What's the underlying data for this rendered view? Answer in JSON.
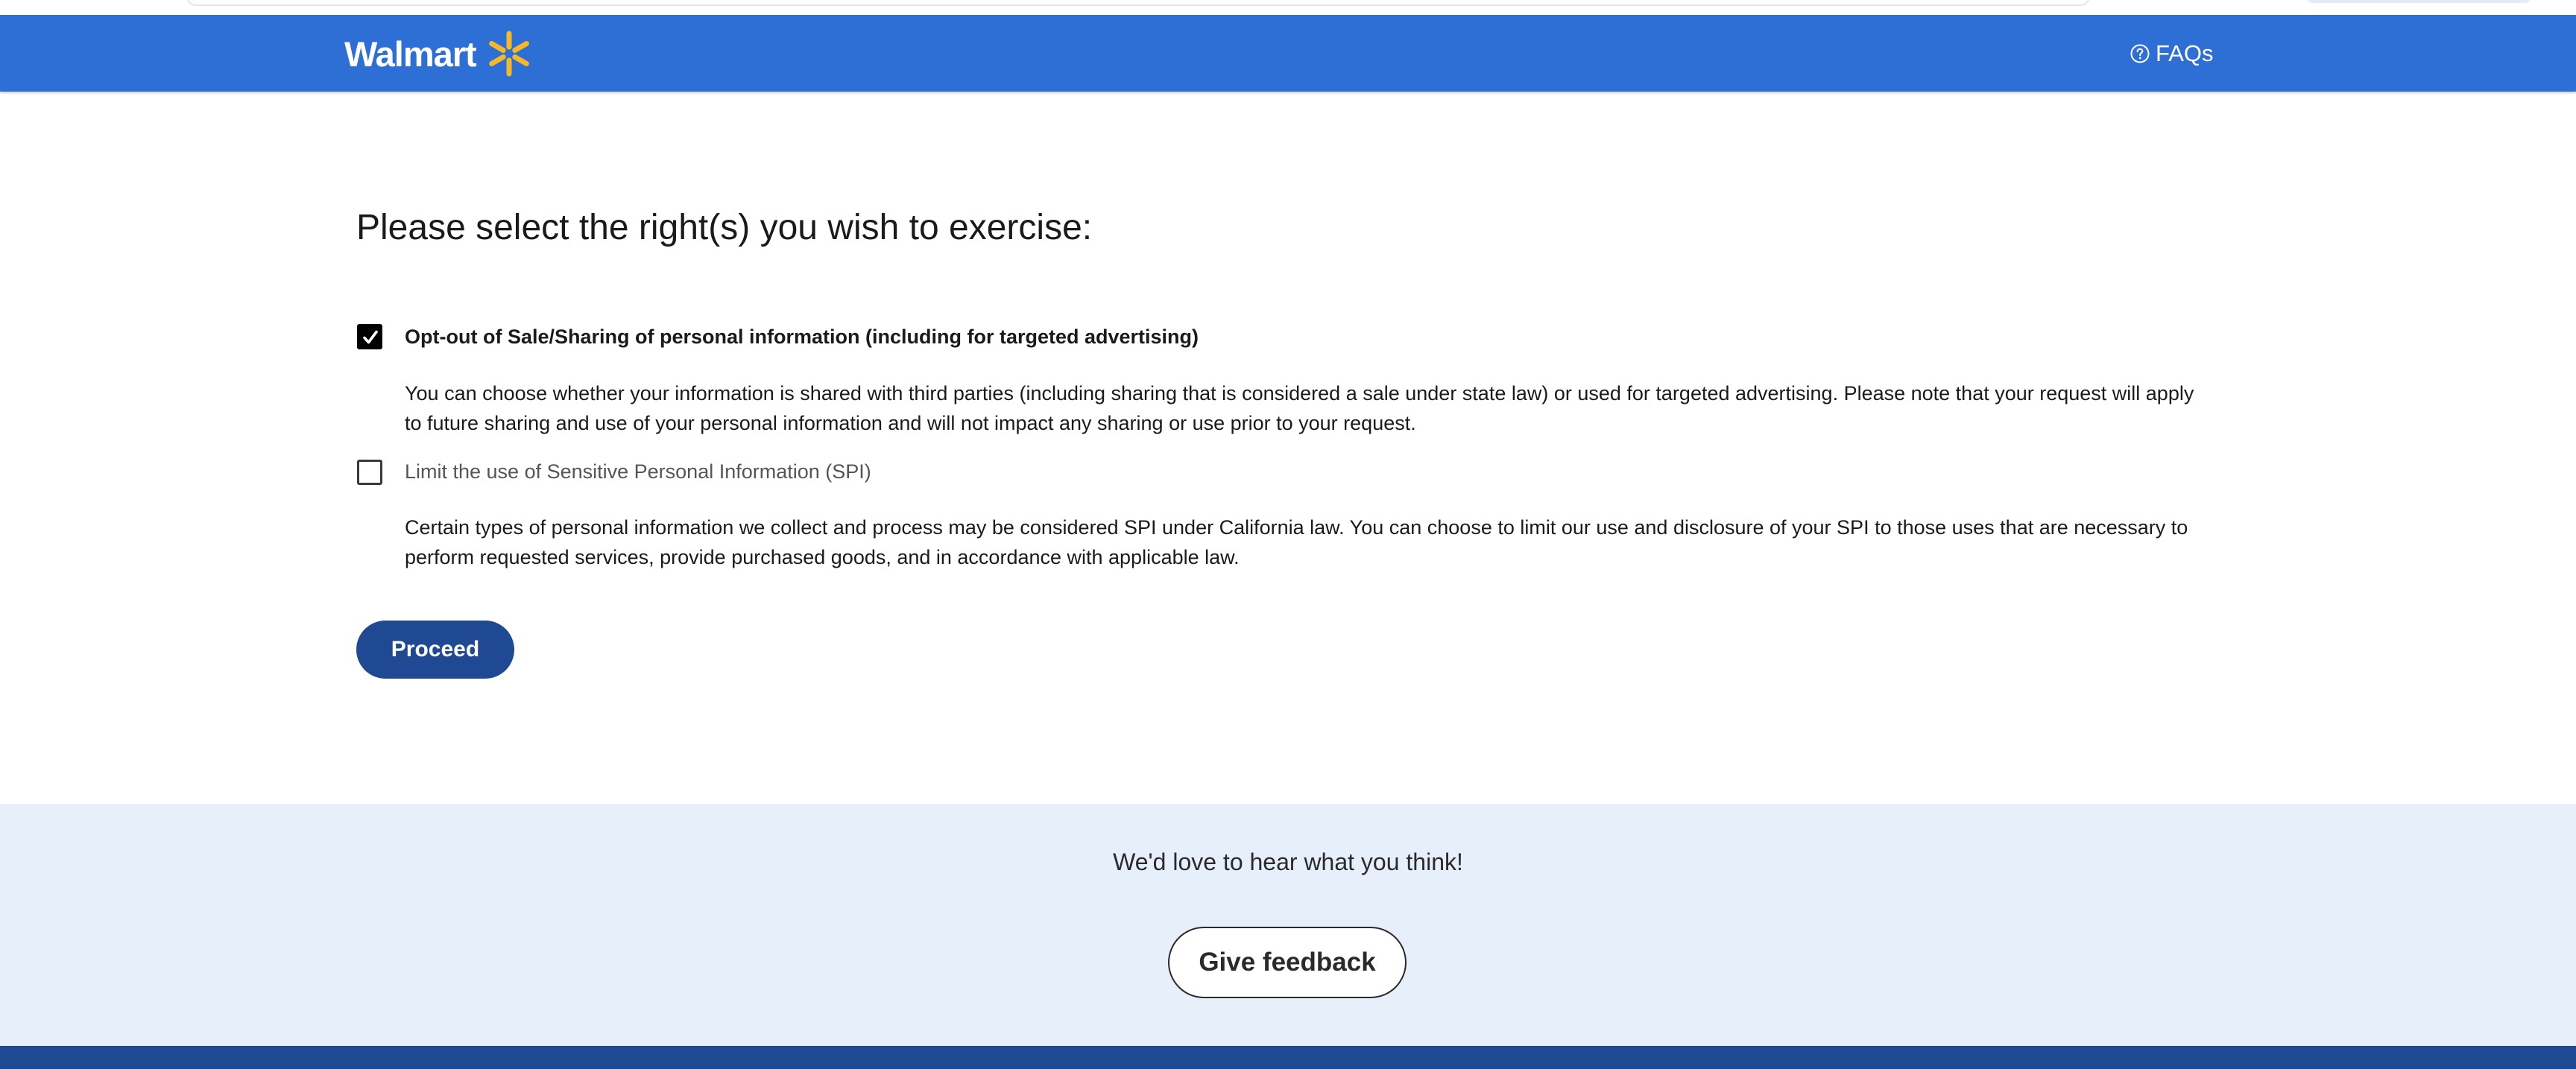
{
  "header": {
    "logo_text": "Walmart",
    "logo_icon": "spark-icon",
    "faq_label": "FAQs",
    "faq_icon": "help-circle-icon",
    "brand_color": "#2e6fd6",
    "spark_color": "#f6b827"
  },
  "main": {
    "title": "Please select the right(s) you wish to exercise:",
    "options": [
      {
        "label": "Opt-out of Sale/Sharing of personal information (including for targeted advertising)",
        "checked": true,
        "description": "You can choose whether your information is shared with third parties (including sharing that is considered a sale under state law) or used for targeted advertising. Please note that your request will apply to future sharing and use of your personal information and will not impact any sharing or use prior to your request."
      },
      {
        "label": "Limit the use of Sensitive Personal Information (SPI)",
        "checked": false,
        "description": "Certain types of personal information we collect and process may be considered SPI under California law. You can choose to limit our use and disclosure of your SPI to those uses that are necessary to perform requested services, provide purchased goods, and in accordance with applicable law."
      }
    ],
    "proceed_label": "Proceed",
    "proceed_color": "#1f4a93"
  },
  "feedback": {
    "prompt": "We'd love to hear what you think!",
    "button_label": "Give feedback",
    "band_color": "#e7effa"
  },
  "footer": {
    "color": "#1d4a92"
  }
}
